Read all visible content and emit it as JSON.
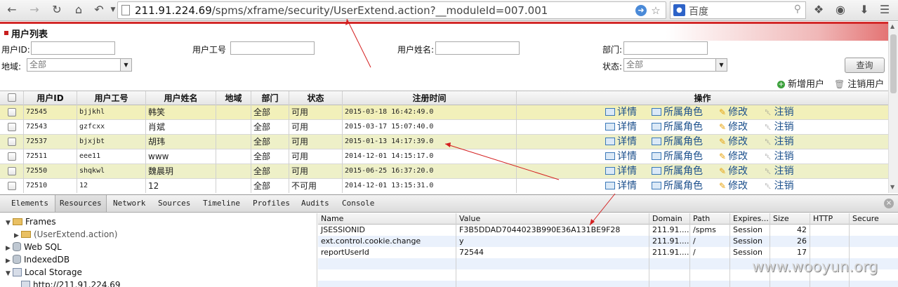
{
  "browser": {
    "url_host": "211.91.224.69",
    "url_path": "/spms/xframe/security/UserExtend.action?__moduleId=007.001",
    "search_engine": "百度"
  },
  "page": {
    "title": "用户列表",
    "filters": {
      "user_id_label": "用户ID:",
      "user_no_label": "用户工号",
      "user_name_label": "用户姓名:",
      "dept_label": "部门:",
      "region_label": "地域:",
      "region_value": "全部",
      "status_label": "状态:",
      "status_value": "全部",
      "query_button": "查询"
    },
    "actions": {
      "add_user": "新增用户",
      "cancel_user": "注销用户"
    },
    "table": {
      "headers": [
        "用户ID",
        "用户工号",
        "用户姓名",
        "地域",
        "部门",
        "状态",
        "注册时间",
        "操作"
      ],
      "op_labels": [
        "详情",
        "所属角色",
        "修改",
        "注销"
      ],
      "rows": [
        {
          "id": "72545",
          "no": "bjjkhl",
          "name": "韩笑",
          "region": "",
          "dept": "全部",
          "status": "可用",
          "time": "2015-03-18 16:42:49.0"
        },
        {
          "id": "72543",
          "no": "gzfcxx",
          "name": "肖斌",
          "region": "",
          "dept": "全部",
          "status": "可用",
          "time": "2015-03-17 15:07:40.0"
        },
        {
          "id": "72537",
          "no": "bjxjbt",
          "name": "胡玮",
          "region": "",
          "dept": "全部",
          "status": "可用",
          "time": "2015-01-13 14:17:39.0"
        },
        {
          "id": "72511",
          "no": "eee11",
          "name": "www",
          "region": "",
          "dept": "全部",
          "status": "可用",
          "time": "2014-12-01 14:15:17.0"
        },
        {
          "id": "72550",
          "no": "shqkwl",
          "name": "魏晨玥",
          "region": "",
          "dept": "全部",
          "status": "可用",
          "time": "2015-06-25 16:37:20.0"
        },
        {
          "id": "72510",
          "no": "12",
          "name": "12",
          "region": "",
          "dept": "全部",
          "status": "不可用",
          "time": "2014-12-01 13:15:31.0"
        }
      ]
    }
  },
  "devtools": {
    "tabs": [
      "Elements",
      "Resources",
      "Network",
      "Sources",
      "Timeline",
      "Profiles",
      "Audits",
      "Console"
    ],
    "active_tab": "Resources",
    "tree": {
      "frames": "Frames",
      "frame_child": "(UserExtend.action)",
      "web_sql": "Web SQL",
      "indexeddb": "IndexedDB",
      "local_storage": "Local Storage",
      "ls_child": "http://211.91.224.69"
    },
    "cookie_headers": [
      "Name",
      "Value",
      "Domain",
      "Path",
      "Expires...",
      "Size",
      "HTTP",
      "Secure"
    ],
    "cookies": [
      {
        "name": "JSESSIONID",
        "value": "F3B5DDAD7044023B990E36A131BE9F28",
        "domain": "211.91....",
        "path": "/spms",
        "expires": "Session",
        "size": "42"
      },
      {
        "name": "ext.control.cookie.change",
        "value": "y",
        "domain": "211.91....",
        "path": "/",
        "expires": "Session",
        "size": "26"
      },
      {
        "name": "reportUserId",
        "value": "72544",
        "domain": "211.91....",
        "path": "/",
        "expires": "Session",
        "size": "17"
      }
    ]
  },
  "watermark": "www.wooyun.org"
}
